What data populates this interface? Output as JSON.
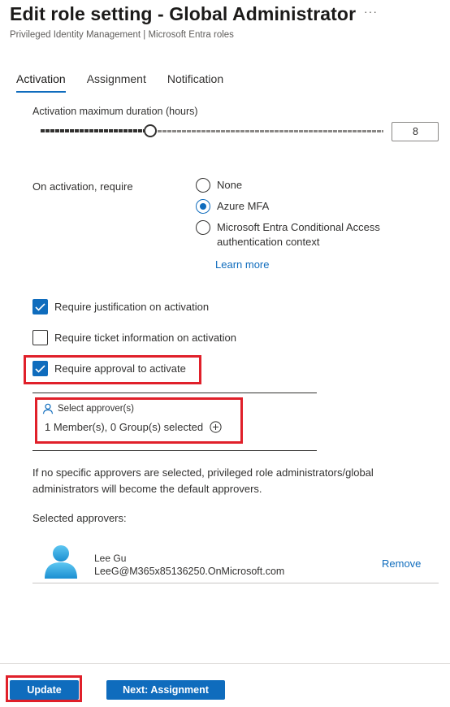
{
  "header": {
    "title": "Edit role setting - Global Administrator",
    "more_label": "···",
    "subtitle": "Privileged Identity Management | Microsoft Entra roles"
  },
  "tabs": [
    {
      "label": "Activation",
      "active": true
    },
    {
      "label": "Assignment",
      "active": false
    },
    {
      "label": "Notification",
      "active": false
    }
  ],
  "activation": {
    "duration_label": "Activation maximum duration (hours)",
    "duration_value": "8",
    "slider_fraction": 0.32,
    "require_label": "On activation, require",
    "options": [
      {
        "label": "None",
        "checked": false
      },
      {
        "label": "Azure MFA",
        "checked": true
      },
      {
        "label": "Microsoft Entra Conditional Access authentication context",
        "checked": false
      }
    ],
    "learn_more": "Learn more",
    "checks": [
      {
        "label": "Require justification on activation",
        "checked": true
      },
      {
        "label": "Require ticket information on activation",
        "checked": false
      },
      {
        "label": "Require approval to activate",
        "checked": true
      }
    ],
    "approver_label": "Select approver(s)",
    "approver_count": "1 Member(s), 0 Group(s) selected",
    "info": "If no specific approvers are selected, privileged role administrators/global administrators will become the default approvers.",
    "selected_label": "Selected approvers:",
    "approvers": [
      {
        "name": "Lee Gu",
        "email": "LeeG@M365x85136250.OnMicrosoft.com",
        "remove": "Remove"
      }
    ]
  },
  "footer": {
    "update": "Update",
    "next": "Next: Assignment"
  },
  "colors": {
    "accent": "#0f6cbd",
    "highlight": "#e0202a"
  }
}
